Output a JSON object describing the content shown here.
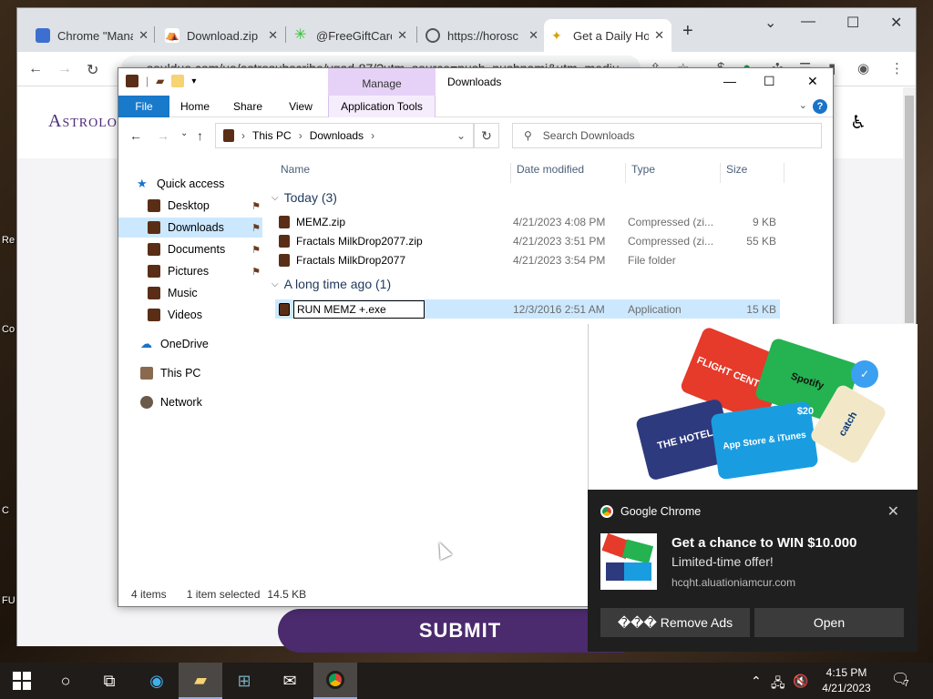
{
  "desktop": {
    "labels": [
      "Re",
      "Co",
      "C",
      "FU"
    ]
  },
  "browser": {
    "tabs": [
      {
        "title": "Chrome \"Mana",
        "icon": "cert-icon",
        "color": "#3d6fd1"
      },
      {
        "title": "Download.zip",
        "icon": "mega-icon",
        "color": "#333333"
      },
      {
        "title": "@FreeGiftCard",
        "icon": "star-icon",
        "color": "#2fc42f"
      },
      {
        "title": "https://horosc",
        "icon": "globe-icon",
        "color": "#555555"
      },
      {
        "title": "Get a Daily Ho",
        "icon": "astro-icon",
        "color": "#d9a400"
      }
    ],
    "address": "soulduo.com/ua/astrosubscribe/vgad-87/?utm_source=push_pushnami&utm_mediu",
    "site_logo": "Astrology",
    "submit_label": "SUBMIT"
  },
  "explorer": {
    "title": "Downloads",
    "context_tab": "Manage",
    "ribbon_tabs": {
      "file": "File",
      "home": "Home",
      "share": "Share",
      "view": "View",
      "app_tools": "Application Tools"
    },
    "breadcrumb": {
      "root": "This PC",
      "current": "Downloads"
    },
    "search_placeholder": "Search Downloads",
    "nav": {
      "quick_access": "Quick access",
      "desktop": "Desktop",
      "downloads": "Downloads",
      "documents": "Documents",
      "pictures": "Pictures",
      "music": "Music",
      "videos": "Videos",
      "onedrive": "OneDrive",
      "this_pc": "This PC",
      "network": "Network"
    },
    "columns": {
      "name": "Name",
      "date": "Date modified",
      "type": "Type",
      "size": "Size"
    },
    "groups": {
      "today": "Today (3)",
      "older": "A long time ago (1)"
    },
    "files": [
      {
        "name": "MEMZ.zip",
        "date": "4/21/2023 4:08 PM",
        "type": "Compressed (zi...",
        "size": "9 KB"
      },
      {
        "name": "Fractals MilkDrop2077.zip",
        "date": "4/21/2023 3:51 PM",
        "type": "Compressed (zi...",
        "size": "55 KB"
      },
      {
        "name": "Fractals MilkDrop2077",
        "date": "4/21/2023 3:54 PM",
        "type": "File folder",
        "size": ""
      }
    ],
    "old_file": {
      "name": "RUN MEMZ +.exe",
      "date": "12/3/2016 2:51 AM",
      "type": "Application",
      "size": "15 KB"
    },
    "status": {
      "items": "4 items",
      "selected": "1 item selected",
      "size": "14.5 KB"
    }
  },
  "notification": {
    "app": "Google Chrome",
    "title": "Get a chance to WIN $10.000",
    "subtitle": "Limited-time offer!",
    "host": "hcqht.aluationiamcur.com",
    "remove_ads": "��� Remove Ads",
    "open": "Open",
    "cards": {
      "flight": "FLIGHT CENTRE",
      "spotify": "Spotify",
      "hotel": "THE HOTEL",
      "itunes": "App Store & iTunes",
      "price": "$20",
      "catch": "catch"
    }
  },
  "taskbar": {
    "time": "4:15 PM",
    "date": "4/21/2023",
    "notif_count": "7"
  }
}
